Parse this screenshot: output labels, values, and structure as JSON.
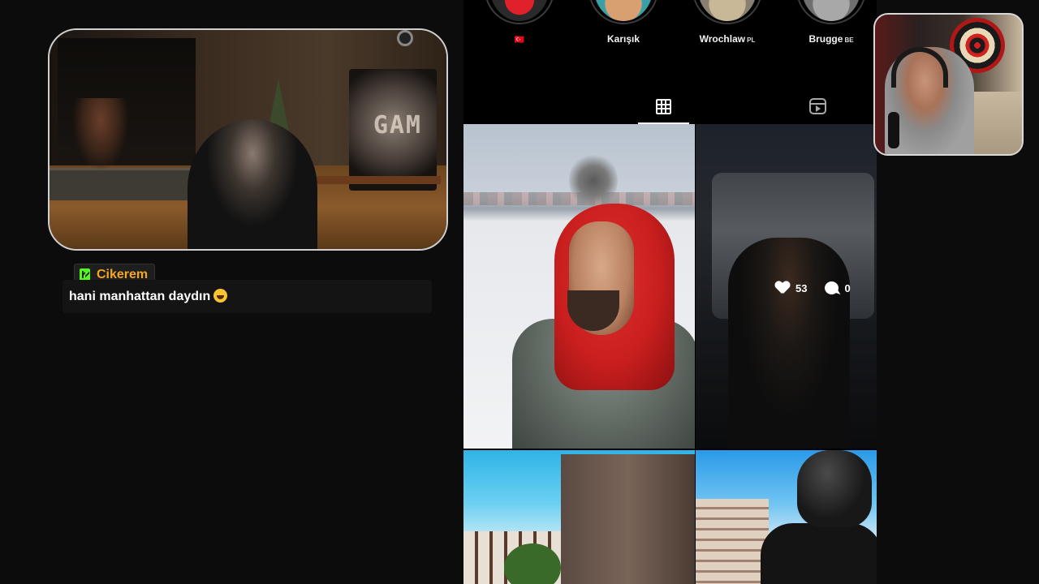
{
  "chat": {
    "username": "Cikerem",
    "message": "hani manhattan daydın",
    "emoji_name": "laughing-emoji",
    "badge_icon": "kick-k-icon",
    "badge_color": "#53fc18",
    "username_color": "#f5a623"
  },
  "guest_cam": {
    "banner_text": "GAM"
  },
  "instagram": {
    "highlights": [
      {
        "label": "",
        "flag": ""
      },
      {
        "label": "Karışık",
        "flag": ""
      },
      {
        "label": "Wrochlaw",
        "flag": "PL"
      },
      {
        "label": "Brugge",
        "flag": "BE"
      }
    ],
    "first_highlight_caption": "🇹🇷",
    "tabs": {
      "posts_icon": "grid-icon",
      "reels_icon": "reels-icon",
      "active": "posts"
    },
    "posts": [
      {
        "description": "selfie-red-hood-snow"
      },
      {
        "description": "selfie-truck",
        "likes": "53",
        "comments": "0"
      },
      {
        "description": "castle-blue-sky"
      },
      {
        "description": "motorcycle-helmet"
      }
    ]
  },
  "colors": {
    "background": "#0c0c0c",
    "panel": "#000000",
    "tab_active": "#f2f2f2",
    "tab_inactive": "#a8a8a8"
  }
}
